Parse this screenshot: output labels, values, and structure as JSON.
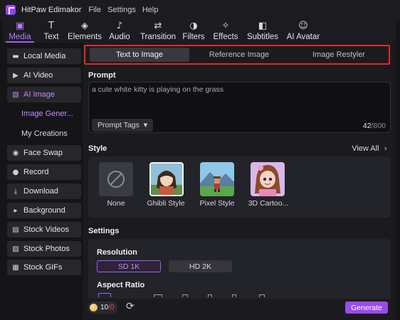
{
  "app": {
    "name": "HitPaw Edimakor",
    "menu": [
      "File",
      "Settings",
      "Help"
    ]
  },
  "toolbar": [
    {
      "label": "Media",
      "icon": "media-icon",
      "glyph": "▣"
    },
    {
      "label": "Text",
      "icon": "text-icon",
      "glyph": "T"
    },
    {
      "label": "Elements",
      "icon": "elements-icon",
      "glyph": "◈"
    },
    {
      "label": "Audio",
      "icon": "audio-icon",
      "glyph": "♪"
    },
    {
      "label": "Transition",
      "icon": "transition-icon",
      "glyph": "⇄"
    },
    {
      "label": "Filters",
      "icon": "filters-icon",
      "glyph": "◑"
    },
    {
      "label": "Effects",
      "icon": "effects-icon",
      "glyph": "✧"
    },
    {
      "label": "Subtitles",
      "icon": "subtitles-icon",
      "glyph": "◧"
    },
    {
      "label": "AI Avatar",
      "icon": "ai-avatar-icon",
      "glyph": "☺"
    }
  ],
  "sidebar": {
    "items": [
      {
        "label": "Local Media",
        "icon": "folder-icon",
        "glyph": "▬"
      },
      {
        "label": "AI Video",
        "icon": "ai-video-icon",
        "glyph": "▶"
      },
      {
        "label": "AI Image",
        "icon": "ai-image-icon",
        "glyph": "▧"
      },
      {
        "label": "Face Swap",
        "icon": "face-swap-icon",
        "glyph": "◉"
      },
      {
        "label": "Record",
        "icon": "record-icon",
        "glyph": "●"
      },
      {
        "label": "Download",
        "icon": "download-icon",
        "glyph": "⤓"
      },
      {
        "label": "Background",
        "icon": "background-icon",
        "glyph": "▸"
      },
      {
        "label": "Stock Videos",
        "icon": "stock-videos-icon",
        "glyph": "▤"
      },
      {
        "label": "Stock Photos",
        "icon": "stock-photos-icon",
        "glyph": "▨"
      },
      {
        "label": "Stock GIFs",
        "icon": "stock-gifs-icon",
        "glyph": "▦"
      }
    ],
    "sub_items": [
      "Image Gener...",
      "My Creations"
    ]
  },
  "tabs": [
    "Text to Image",
    "Reference Image",
    "Image Restyler"
  ],
  "prompt": {
    "title": "Prompt",
    "value": "a cute white kitty is playing on the grass",
    "tags_label": "Prompt Tags",
    "count": "42",
    "max": "/800"
  },
  "style": {
    "title": "Style",
    "view_all": "View All",
    "options": [
      "None",
      "Ghibli Style",
      "Pixel Style",
      "3D Cartoo..."
    ]
  },
  "settings": {
    "title": "Settings",
    "resolution_label": "Resolution",
    "resolutions": [
      "SD 1K",
      "HD 2K"
    ],
    "aspect_label": "Aspect Ratio"
  },
  "footer": {
    "credits_have": "10",
    "credits_need": "/0",
    "generate_label": "Generate"
  },
  "colors": {
    "accent": "#a45cf4",
    "highlight_box": "#e02a2a",
    "generate": "#9b4be8"
  }
}
